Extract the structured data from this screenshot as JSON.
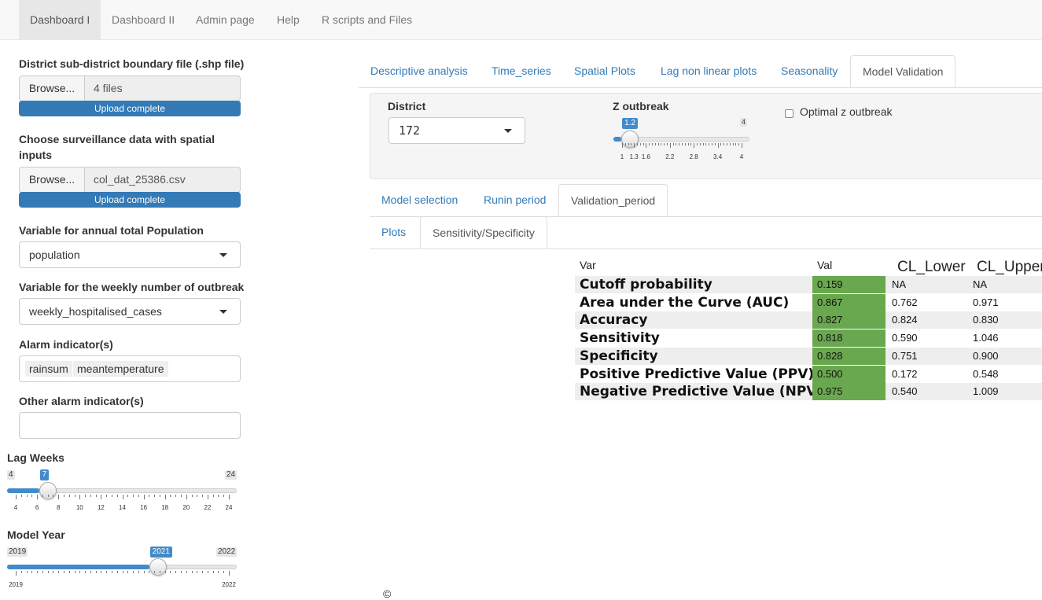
{
  "navbar": {
    "items": [
      {
        "label": "Dashboard I",
        "active": true
      },
      {
        "label": "Dashboard II",
        "active": false
      },
      {
        "label": "Admin page",
        "active": false
      },
      {
        "label": "Help",
        "active": false
      },
      {
        "label": "R scripts and Files",
        "active": false
      }
    ]
  },
  "sidebar": {
    "shp_label": "District sub-district boundary file (.shp file)",
    "shp_browse": "Browse...",
    "shp_value": "4 files",
    "shp_status": "Upload complete",
    "surv_label_line1": "Choose surveillance data with spatial",
    "surv_label_line2": "inputs",
    "surv_browse": "Browse...",
    "surv_value": "col_dat_25386.csv",
    "surv_status": "Upload complete",
    "pop_label": "Variable for annual total Population",
    "pop_value": "population",
    "outbreak_label": "Variable for the weekly number of outbreak",
    "outbreak_value": "weekly_hospitalised_cases",
    "alarm_label": "Alarm indicator(s)",
    "alarm_tags": [
      "rainsum",
      "meantemperature"
    ],
    "other_alarm_label": "Other alarm indicator(s)",
    "other_alarm_value": "",
    "lag": {
      "label": "Lag Weeks",
      "min": 4,
      "max": 24,
      "value": 7,
      "min_label": "4",
      "max_label": "24",
      "value_label": "7",
      "ticks": [
        "4",
        "6",
        "8",
        "10",
        "12",
        "14",
        "16",
        "18",
        "20",
        "22",
        "24"
      ]
    },
    "year": {
      "label": "Model Year",
      "min": 2019,
      "max": 2022,
      "value": 2021,
      "min_label": "2019",
      "max_label": "2022",
      "value_label": "2021",
      "ticks": [
        "2019",
        "2022"
      ]
    }
  },
  "main": {
    "tabs": [
      {
        "label": "Descriptive analysis",
        "active": false
      },
      {
        "label": "Time_series",
        "active": false
      },
      {
        "label": "Spatial Plots",
        "active": false
      },
      {
        "label": "Lag non linear plots",
        "active": false
      },
      {
        "label": "Seasonality",
        "active": false
      },
      {
        "label": "Model Validation",
        "active": true
      }
    ],
    "district_label": "District",
    "district_value": "172",
    "z_label": "Z outbreak",
    "z": {
      "min": 1,
      "max": 4,
      "value": 1.2,
      "max_label": "4",
      "value_label": "1.2",
      "ticks": [
        "1",
        "1.3",
        "1.6",
        "2.2",
        "2.8",
        "3.4",
        "4"
      ]
    },
    "optimal_label": "Optimal z outbreak",
    "optimal_checked": false,
    "subtabs": [
      {
        "label": "Model selection",
        "active": false
      },
      {
        "label": "Runin period",
        "active": false
      },
      {
        "label": "Validation_period",
        "active": true
      }
    ],
    "subsubtabs": [
      {
        "label": "Plots",
        "active": false
      },
      {
        "label": "Sensitivity/Specificity",
        "active": true
      }
    ],
    "table": {
      "headers": [
        "Var",
        "Val",
        "CL_Lower",
        "CL_Upper"
      ],
      "rows": [
        {
          "var": "Cutoff probability",
          "val": "0.159",
          "lower": "NA",
          "upper": "NA"
        },
        {
          "var": "Area under the Curve (AUC)",
          "val": "0.867",
          "lower": "0.762",
          "upper": "0.971"
        },
        {
          "var": "Accuracy",
          "val": "0.827",
          "lower": "0.824",
          "upper": "0.830"
        },
        {
          "var": "Sensitivity",
          "val": "0.818",
          "lower": "0.590",
          "upper": "1.046"
        },
        {
          "var": "Specificity",
          "val": "0.828",
          "lower": "0.751",
          "upper": "0.900"
        },
        {
          "var": "Positive Predictive Value (PPV)",
          "val": "0.500",
          "lower": "0.172",
          "upper": "0.548"
        },
        {
          "var": "Negative Predictive Value (NPV)",
          "val": "0.975",
          "lower": "0.540",
          "upper": "1.009"
        }
      ]
    },
    "footer_mark": "©"
  },
  "colors": {
    "accent": "#337ab7",
    "slider_fill": "#428bca",
    "val_cell": "#6aa84f",
    "row_stripe": "#eeeeee"
  }
}
